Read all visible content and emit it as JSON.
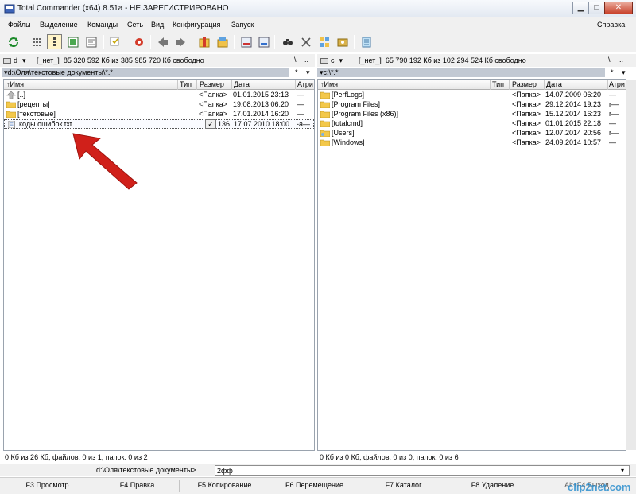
{
  "window": {
    "title": "Total Commander (x64) 8.51a - НЕ ЗАРЕГИСТРИРОВАНО",
    "minimize": "▁",
    "maximize": "□",
    "close": "✕"
  },
  "menu": {
    "items": [
      "Файлы",
      "Выделение",
      "Команды",
      "Сеть",
      "Вид",
      "Конфигурация",
      "Запуск"
    ],
    "help": "Справка"
  },
  "toolbar": {
    "icons": [
      "refresh-icon",
      "brief-view-icon",
      "detailed-view-icon",
      "thumbnails-icon",
      "tree-icon",
      "unselect-icon",
      "back-icon",
      "forward-icon",
      "pack-icon",
      "unpack-icon",
      "ftp-icon",
      "url-icon",
      "find-icon",
      "rename-icon",
      "sync-icon",
      "compare-icon",
      "notepad-icon"
    ]
  },
  "left": {
    "drive_letter": "d",
    "drive_label": "[_нет_]",
    "drive_info": "85 320 592 Кб из 385 985 720 Кб свободно",
    "root_btn": "\\",
    "up_btn": "..",
    "path": "▾d:\\Оля\\текстовые документы\\*.*",
    "path_star": "*",
    "path_arrow": "▾",
    "columns": {
      "name": "↑Имя",
      "type": "Тип",
      "size": "Размер",
      "date": "Дата",
      "attr": "Атри"
    },
    "rows": [
      {
        "name": "[..]",
        "size": "<Папка>",
        "date": "01.01.2015 23:13",
        "attr": "—"
      },
      {
        "name": "[рецепты]",
        "size": "<Папка>",
        "date": "19.08.2013 06:20",
        "attr": "—"
      },
      {
        "name": "[текстовые]",
        "size": "<Папка>",
        "date": "17.01.2014 16:20",
        "attr": "—"
      },
      {
        "name": "коды ошибок.txt",
        "size": "136",
        "date": "17.07.2010 18:00",
        "attr": "-a—"
      }
    ],
    "status": "0 Кб из 26 Кб, файлов: 0 из 1, папок: 0 из 2"
  },
  "right": {
    "drive_letter": "c",
    "drive_label": "[_нет_]",
    "drive_info": "65 790 192 Кб из 102 294 524 Кб свободно",
    "root_btn": "\\",
    "up_btn": "..",
    "path": "▾c:\\*.*",
    "path_star": "*",
    "path_arrow": "▾",
    "columns": {
      "name": "↑Имя",
      "type": "Тип",
      "size": "Размер",
      "date": "Дата",
      "attr": "Атри"
    },
    "rows": [
      {
        "name": "[PerfLogs]",
        "size": "<Папка>",
        "date": "14.07.2009 06:20",
        "attr": "—"
      },
      {
        "name": "[Program Files]",
        "size": "<Папка>",
        "date": "29.12.2014 19:23",
        "attr": "r—"
      },
      {
        "name": "[Program Files (x86)]",
        "size": "<Папка>",
        "date": "15.12.2014 16:23",
        "attr": "r—"
      },
      {
        "name": "[totalcmd]",
        "size": "<Папка>",
        "date": "01.01.2015 22:18",
        "attr": "—"
      },
      {
        "name": "[Users]",
        "size": "<Папка>",
        "date": "12.07.2014 20:56",
        "attr": "r—"
      },
      {
        "name": "[Windows]",
        "size": "<Папка>",
        "date": "24.09.2014 10:57",
        "attr": "—"
      }
    ],
    "status": "0 Кб из 0 Кб, файлов: 0 из 0, папок: 0 из 6"
  },
  "cmdline": {
    "label": "d:\\Оля\\текстовые документы>",
    "value": "2фф",
    "drop": "▾"
  },
  "fkeys": [
    "F3 Просмотр",
    "F4 Правка",
    "F5 Копирование",
    "F6 Перемещение",
    "F7 Каталог",
    "F8 Удаление",
    "Alt+F4 Выход"
  ],
  "check_mark": "✓",
  "watermark": "clip2net.com",
  "colors": {
    "folder": "#f3c84b",
    "arrow": "#d0201a",
    "pathbar": "#c2c9d3"
  }
}
